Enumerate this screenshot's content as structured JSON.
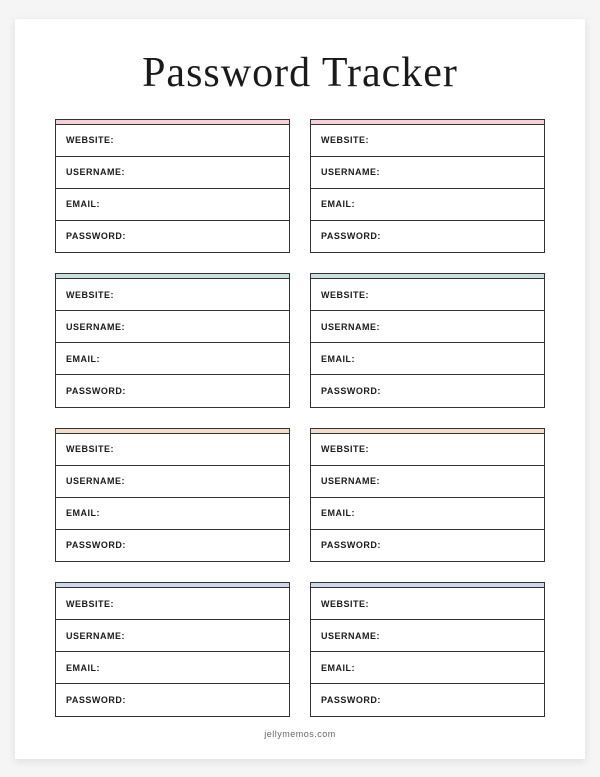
{
  "title": "Password Tracker",
  "footer": "jellymemos.com",
  "fields": {
    "website": "WEBSITE:",
    "username": "USERNAME:",
    "email": "EMAIL:",
    "password": "PASSWORD:"
  },
  "accents": {
    "row1": "#f5d0d6",
    "row2": "#c8e0dd",
    "row3": "#f5dcc8",
    "row4": "#cdd6ed"
  }
}
